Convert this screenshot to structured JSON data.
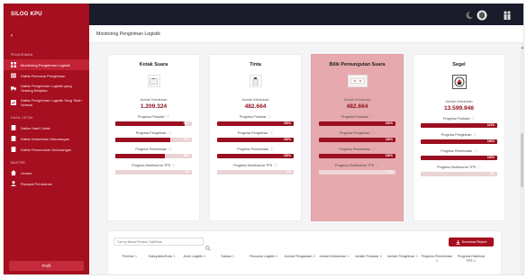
{
  "app": {
    "brand": "SILOG KPU"
  },
  "sidebar": {
    "section_main": "PENGIRIMAN",
    "section_report": "HASIL CETAK",
    "section_master": "MASTER",
    "items": [
      {
        "label": "Monitoring Pengiriman Logistik",
        "icon": "grid-icon"
      },
      {
        "label": "Daftar Rencana Pengiriman",
        "icon": "list-icon"
      },
      {
        "label": "Daftar Pengiriman Logistik yang Sedang Berjalan",
        "icon": "truck-icon"
      },
      {
        "label": "Daftar Pengiriman Logistik Yang Telah Selesai",
        "icon": "check-icon"
      },
      {
        "label": "Daftar Hasil Cetak",
        "icon": "doc-icon"
      },
      {
        "label": "Daftar Kebutuhan Kekurangan",
        "icon": "doc-icon"
      },
      {
        "label": "Daftar Pemenuhan Kekurangan",
        "icon": "doc-icon"
      },
      {
        "label": "Vendor",
        "icon": "home-icon"
      },
      {
        "label": "Riwayat Perubahan",
        "icon": "user-icon"
      }
    ],
    "profile_label": "Profil"
  },
  "page": {
    "title": "Monitoring Pengiriman Logistik"
  },
  "cards": [
    {
      "title": "Kotak Suara",
      "kebutuhan_label": "Jumlah Kebutuhan",
      "kebutuhan_value": "1.209.324",
      "progress": [
        {
          "label": "Progress Produksi",
          "value": "90%"
        },
        {
          "label": "Progress Pengiriman",
          "value": "72%"
        },
        {
          "label": "Progress Penerimaan",
          "value": "65%"
        },
        {
          "label": "Progress Distribusi ke TPS",
          "value": "0%"
        }
      ]
    },
    {
      "title": "Tinta",
      "kebutuhan_label": "Jumlah Kebutuhan",
      "kebutuhan_value": "482.664",
      "progress": [
        {
          "label": "Progress Produksi",
          "value": "100%"
        },
        {
          "label": "Progress Pengiriman",
          "value": "100%"
        },
        {
          "label": "Progress Penerimaan",
          "value": "100%"
        },
        {
          "label": "Progress Distribusi ke TPS",
          "value": "0%"
        }
      ]
    },
    {
      "title": "Bilik Pemungutan Suara",
      "kebutuhan_label": "Jumlah Kebutuhan",
      "kebutuhan_value": "482.664",
      "progress": [
        {
          "label": "Progress Produksi",
          "value": "100%"
        },
        {
          "label": "Progress Pengiriman",
          "value": "100%"
        },
        {
          "label": "Progress Penerimaan",
          "value": "100%"
        },
        {
          "label": "Progress Distribusi ke TPS",
          "value": "0%"
        }
      ]
    },
    {
      "title": "Segel",
      "kebutuhan_label": "Jumlah Kebutuhan",
      "kebutuhan_value": "13.599.946",
      "progress": [
        {
          "label": "Progress Produksi",
          "value": "101%"
        },
        {
          "label": "Progress Pengiriman",
          "value": "100%"
        },
        {
          "label": "Progress Penerimaan",
          "value": "100%"
        },
        {
          "label": "Progress Distribusi ke TPS",
          "value": "0%"
        }
      ]
    }
  ],
  "progress_fill": [
    [
      0.9,
      0.72,
      0.65,
      0.0
    ],
    [
      1.0,
      1.0,
      1.0,
      0.0
    ],
    [
      1.0,
      1.0,
      1.0,
      0.0
    ],
    [
      1.0,
      1.0,
      1.0,
      0.0
    ]
  ],
  "table": {
    "search_placeholder": "Cari by Nama Provinsi, Kab/Kota",
    "download_label": "Download Report",
    "columns": [
      "Provinsi",
      "Kabupaten/Kota",
      "Jenis Logistik",
      "Satuan",
      "Rencana Logistik",
      "Jumlah Pengadaan",
      "Jumlah Kebutuhan",
      "Jumlah Produksi",
      "Jumlah Pengiriman",
      "Progress Penerimaan",
      "Progress Distribusi TPS"
    ]
  },
  "colors": {
    "brand": "#a50f1f",
    "topbar": "#1a1c2b",
    "highlight_card": "#e6a9ad"
  }
}
